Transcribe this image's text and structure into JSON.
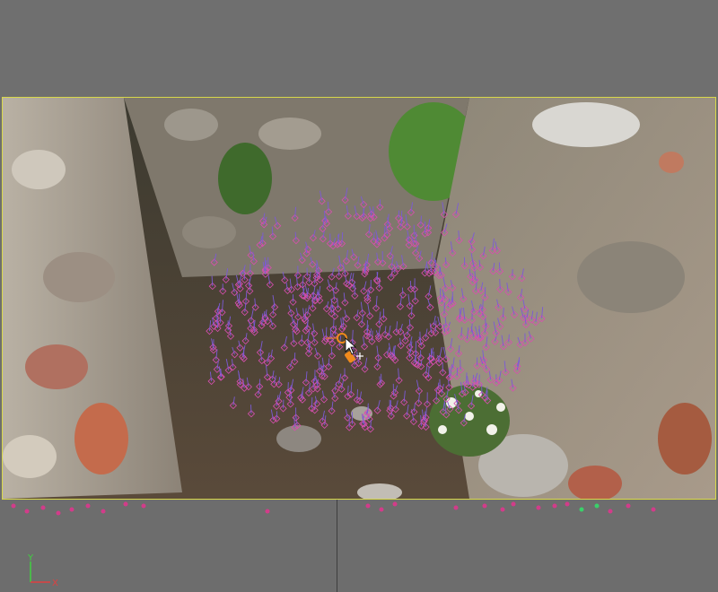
{
  "viewport": {
    "frame_color": "#d8d84a",
    "marker_color": "#7b5bd6",
    "pink_marker_color": "#d23c8a",
    "green_marker_color": "#3ad06a",
    "cursor_color": "#f08a1c"
  },
  "axis": {
    "x_label": "X",
    "y_label": "Y",
    "x_color": "#e04040",
    "y_color": "#40d040"
  },
  "icons": {
    "cursor": "pointer-cursor-icon",
    "move": "move-plus-icon",
    "pin": "pin-icon"
  }
}
